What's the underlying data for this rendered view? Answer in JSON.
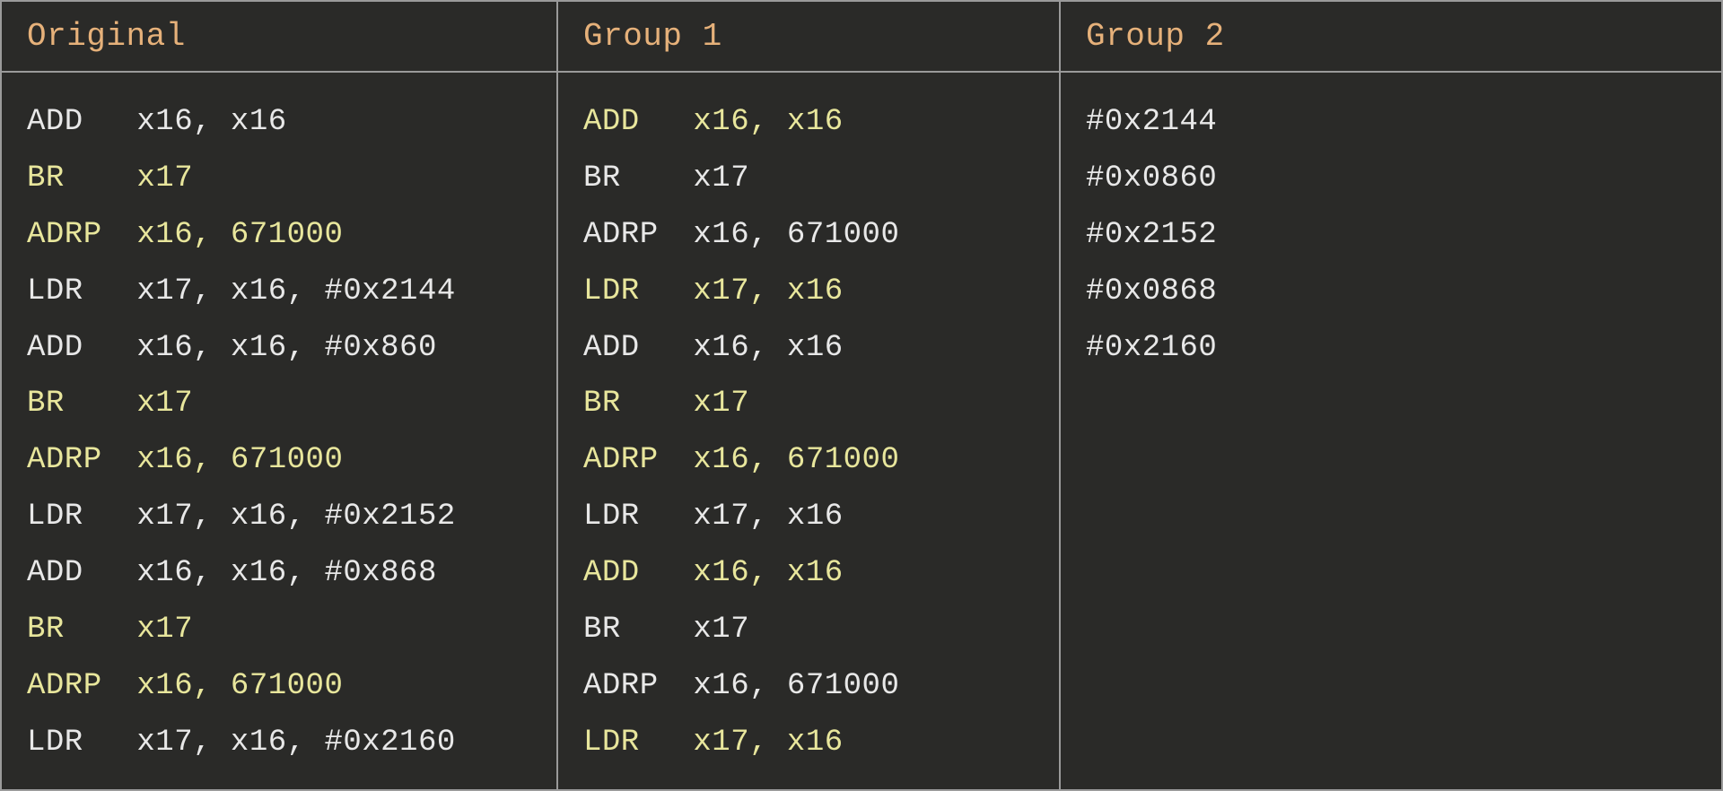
{
  "headers": {
    "original": "Original",
    "group1": "Group 1",
    "group2": "Group 2"
  },
  "colors": {
    "background": "#2a2a28",
    "header_text": "#e6b17a",
    "highlight": "#e8e69c",
    "plain": "#e8e8e8",
    "border": "#9a9a9a"
  },
  "original": [
    {
      "hl": false,
      "op": "ADD",
      "args": "x16, x16"
    },
    {
      "hl": true,
      "op": "BR",
      "args": "x17"
    },
    {
      "hl": true,
      "op": "ADRP",
      "args": "x16, 671000"
    },
    {
      "hl": false,
      "op": "LDR",
      "args": "x17, x16, #0x2144"
    },
    {
      "hl": false,
      "op": "ADD",
      "args": "x16, x16, #0x860"
    },
    {
      "hl": true,
      "op": "BR",
      "args": "x17"
    },
    {
      "hl": true,
      "op": "ADRP",
      "args": "x16, 671000"
    },
    {
      "hl": false,
      "op": "LDR",
      "args": "x17, x16, #0x2152"
    },
    {
      "hl": false,
      "op": "ADD",
      "args": "x16, x16, #0x868"
    },
    {
      "hl": true,
      "op": "BR",
      "args": "x17"
    },
    {
      "hl": true,
      "op": "ADRP",
      "args": "x16, 671000"
    },
    {
      "hl": false,
      "op": "LDR",
      "args": "x17, x16, #0x2160"
    }
  ],
  "group1": [
    {
      "hl": true,
      "op": "ADD",
      "args": "x16, x16"
    },
    {
      "hl": false,
      "op": "BR",
      "args": "x17"
    },
    {
      "hl": false,
      "op": "ADRP",
      "args": "x16, 671000"
    },
    {
      "hl": true,
      "op": "LDR",
      "args": "x17, x16"
    },
    {
      "hl": false,
      "op": "ADD",
      "args": "x16, x16"
    },
    {
      "hl": true,
      "op": "BR",
      "args": "x17"
    },
    {
      "hl": true,
      "op": "ADRP",
      "args": "x16, 671000"
    },
    {
      "hl": false,
      "op": "LDR",
      "args": "x17, x16"
    },
    {
      "hl": true,
      "op": "ADD",
      "args": "x16, x16"
    },
    {
      "hl": false,
      "op": "BR",
      "args": "x17"
    },
    {
      "hl": false,
      "op": "ADRP",
      "args": "x16, 671000"
    },
    {
      "hl": true,
      "op": "LDR",
      "args": "x17, x16"
    }
  ],
  "group2": [
    "#0x2144",
    "#0x0860",
    "#0x2152",
    "#0x0868",
    "#0x2160"
  ]
}
